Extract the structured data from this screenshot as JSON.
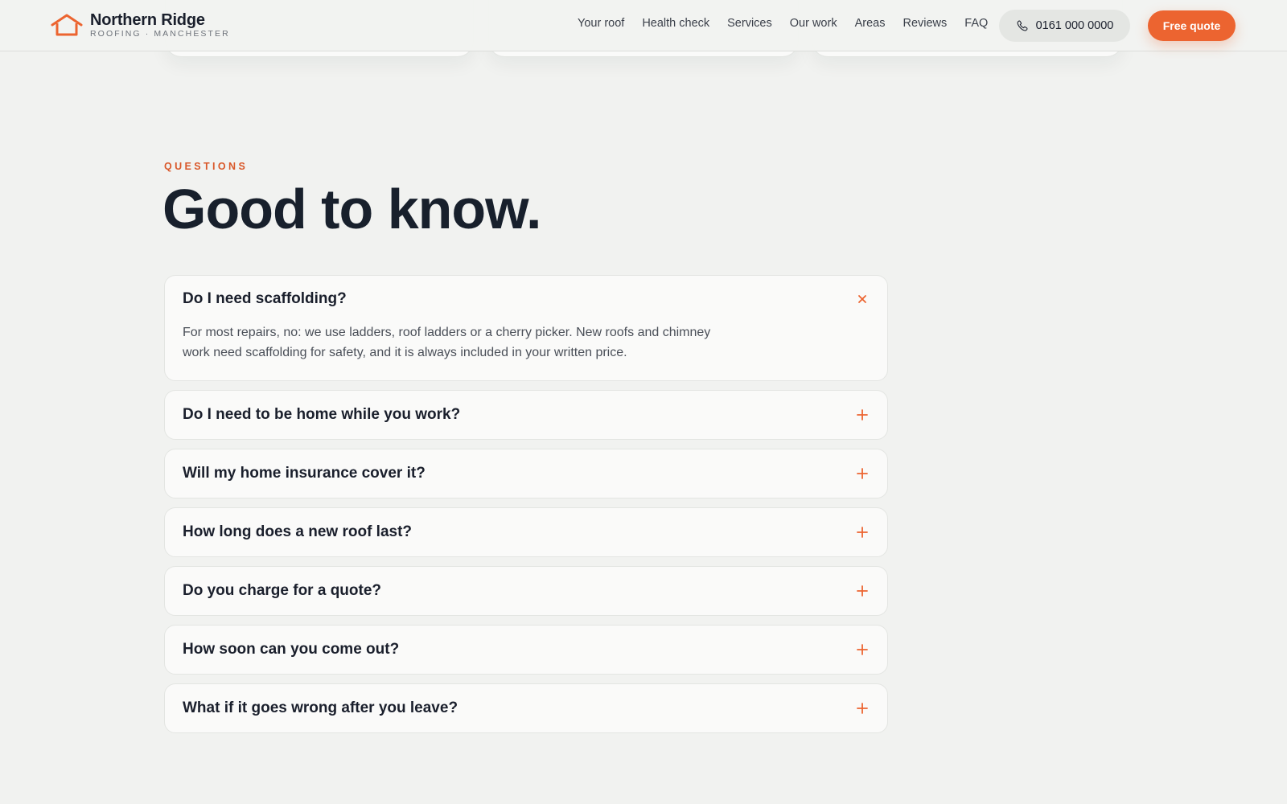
{
  "brand": {
    "name": "Northern Ridge",
    "tagline": "ROOFING · MANCHESTER",
    "accent": "#ec6430"
  },
  "nav": {
    "items": [
      "Your roof",
      "Health check",
      "Services",
      "Our work",
      "Areas",
      "Reviews",
      "FAQ"
    ],
    "phone": "0161 000 0000",
    "phone_icon": "phone-icon",
    "cta": "Free quote"
  },
  "section": {
    "eyebrow": "QUESTIONS",
    "title": "Good to know."
  },
  "faq": [
    {
      "question": "Do I need scaffolding?",
      "answer": "For most repairs, no: we use ladders, roof ladders or a cherry picker. New roofs and chimney work need scaffolding for safety, and it is always included in your written price.",
      "open": true,
      "icon": "close-icon"
    },
    {
      "question": "Do I need to be home while you work?",
      "open": false,
      "icon": "plus-icon"
    },
    {
      "question": "Will my home insurance cover it?",
      "open": false,
      "icon": "plus-icon"
    },
    {
      "question": "How long does a new roof last?",
      "open": false,
      "icon": "plus-icon"
    },
    {
      "question": "Do you charge for a quote?",
      "open": false,
      "icon": "plus-icon"
    },
    {
      "question": "How soon can you come out?",
      "open": false,
      "icon": "plus-icon"
    },
    {
      "question": "What if it goes wrong after you leave?",
      "open": false,
      "icon": "plus-icon"
    }
  ]
}
